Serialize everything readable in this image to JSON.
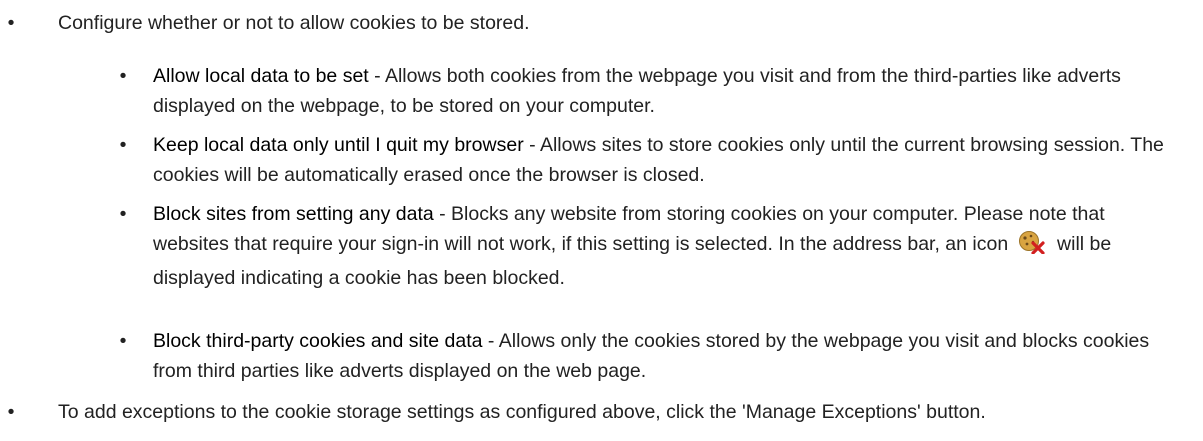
{
  "intro_item": "Configure whether or not to allow cookies to be stored.",
  "options": [
    {
      "term": "Allow local data to be set",
      "description": " - Allows both cookies from the webpage you visit and from the third-parties like adverts displayed on the webpage, to be stored on your computer."
    },
    {
      "term": "Keep local data only until I quit my browser",
      "description": " - Allows sites to store cookies only until the current browsing session. The cookies will be automatically erased once the browser is closed."
    },
    {
      "term": "Block sites from setting any data",
      "description_before_icon": " - Blocks any website from storing cookies on your computer. Please note that websites that require your sign-in will not work, if this setting is selected. In the address bar, an icon",
      "icon": "cookie-blocked-icon",
      "description_after_icon": "will be displayed indicating a cookie has been blocked."
    },
    {
      "term": "Block third-party cookies and site data",
      "description": " - Allows only the cookies stored by the webpage you visit and blocks cookies from third parties like adverts displayed on the web page."
    }
  ],
  "exceptions_item": "To add exceptions to the cookie storage settings as configured above, click the 'Manage Exceptions' button.",
  "bullet": "•",
  "colors": {
    "text": "#222222",
    "term": "#000000",
    "cookie": "#d9a441",
    "blocked_x": "#d21f1f"
  }
}
